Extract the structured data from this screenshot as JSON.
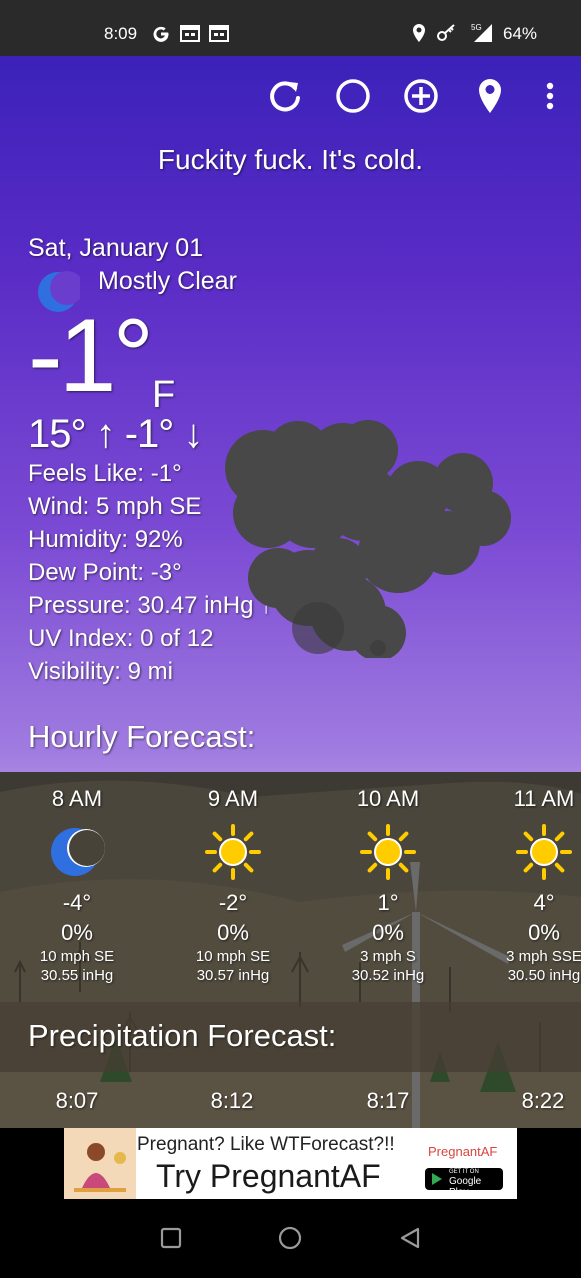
{
  "status_bar": {
    "time": "8:09",
    "battery": "64%",
    "network": "5G",
    "left_icons": [
      "google-icon",
      "calendar-icon",
      "calendar-icon"
    ],
    "right_icons": [
      "location-icon",
      "key-icon",
      "signal-icon"
    ]
  },
  "toolbar": {
    "icons": [
      "refresh-icon",
      "theme-icon",
      "add-location-icon",
      "location-pin-icon",
      "more-vert-icon"
    ]
  },
  "headline": "Fuckity fuck. It's cold.",
  "current": {
    "date": "Sat, January 01",
    "condition": "Mostly Clear",
    "condition_icon": "moon-icon",
    "temp": "-1°",
    "unit": "F",
    "hilo": "15° ↑  -1° ↓",
    "details": [
      {
        "label": "Feels Like:",
        "value": "-1°"
      },
      {
        "label": "Wind:",
        "value": "5 mph SE"
      },
      {
        "label": "Humidity:",
        "value": "92%"
      },
      {
        "label": "Dew Point:",
        "value": "-3°"
      },
      {
        "label": "Pressure:",
        "value": "30.47 inHg ↑"
      },
      {
        "label": "UV Index:",
        "value": "0 of 12"
      },
      {
        "label": "Visibility:",
        "value": "9 mi"
      }
    ]
  },
  "hourly": {
    "title": "Hourly Forecast:",
    "items": [
      {
        "time": "8 AM",
        "icon": "moon-icon",
        "temp": "-4°",
        "pop": "0%",
        "wind": "10 mph SE",
        "pressure": "30.55 inHg"
      },
      {
        "time": "9 AM",
        "icon": "sun-icon",
        "temp": "-2°",
        "pop": "0%",
        "wind": "10 mph SE",
        "pressure": "30.57 inHg"
      },
      {
        "time": "10 AM",
        "icon": "sun-icon",
        "temp": "1°",
        "pop": "0%",
        "wind": "3 mph S",
        "pressure": "30.52 inHg"
      },
      {
        "time": "11 AM",
        "icon": "sun-icon",
        "temp": "4°",
        "pop": "0%",
        "wind": "3 mph SSE",
        "pressure": "30.50 inHg"
      }
    ]
  },
  "precipitation": {
    "title": "Precipitation Forecast:",
    "times": [
      "8:07",
      "8:12",
      "8:17",
      "8:22"
    ]
  },
  "ad": {
    "line1": "Pregnant? Like WTForecast?!!",
    "brand": "PregnantAF",
    "line2": "Try PregnantAF",
    "store_small": "GET IT ON",
    "store": "Google Play"
  },
  "nav": {
    "icons": [
      "recents-icon",
      "home-icon",
      "back-icon"
    ]
  },
  "colors": {
    "sky_top": "#3b22b9",
    "sky_bottom": "#cfb0ec",
    "moon": "#2f6fe0",
    "sun": "#ffcc00",
    "cloud": "#4a4a4a"
  }
}
